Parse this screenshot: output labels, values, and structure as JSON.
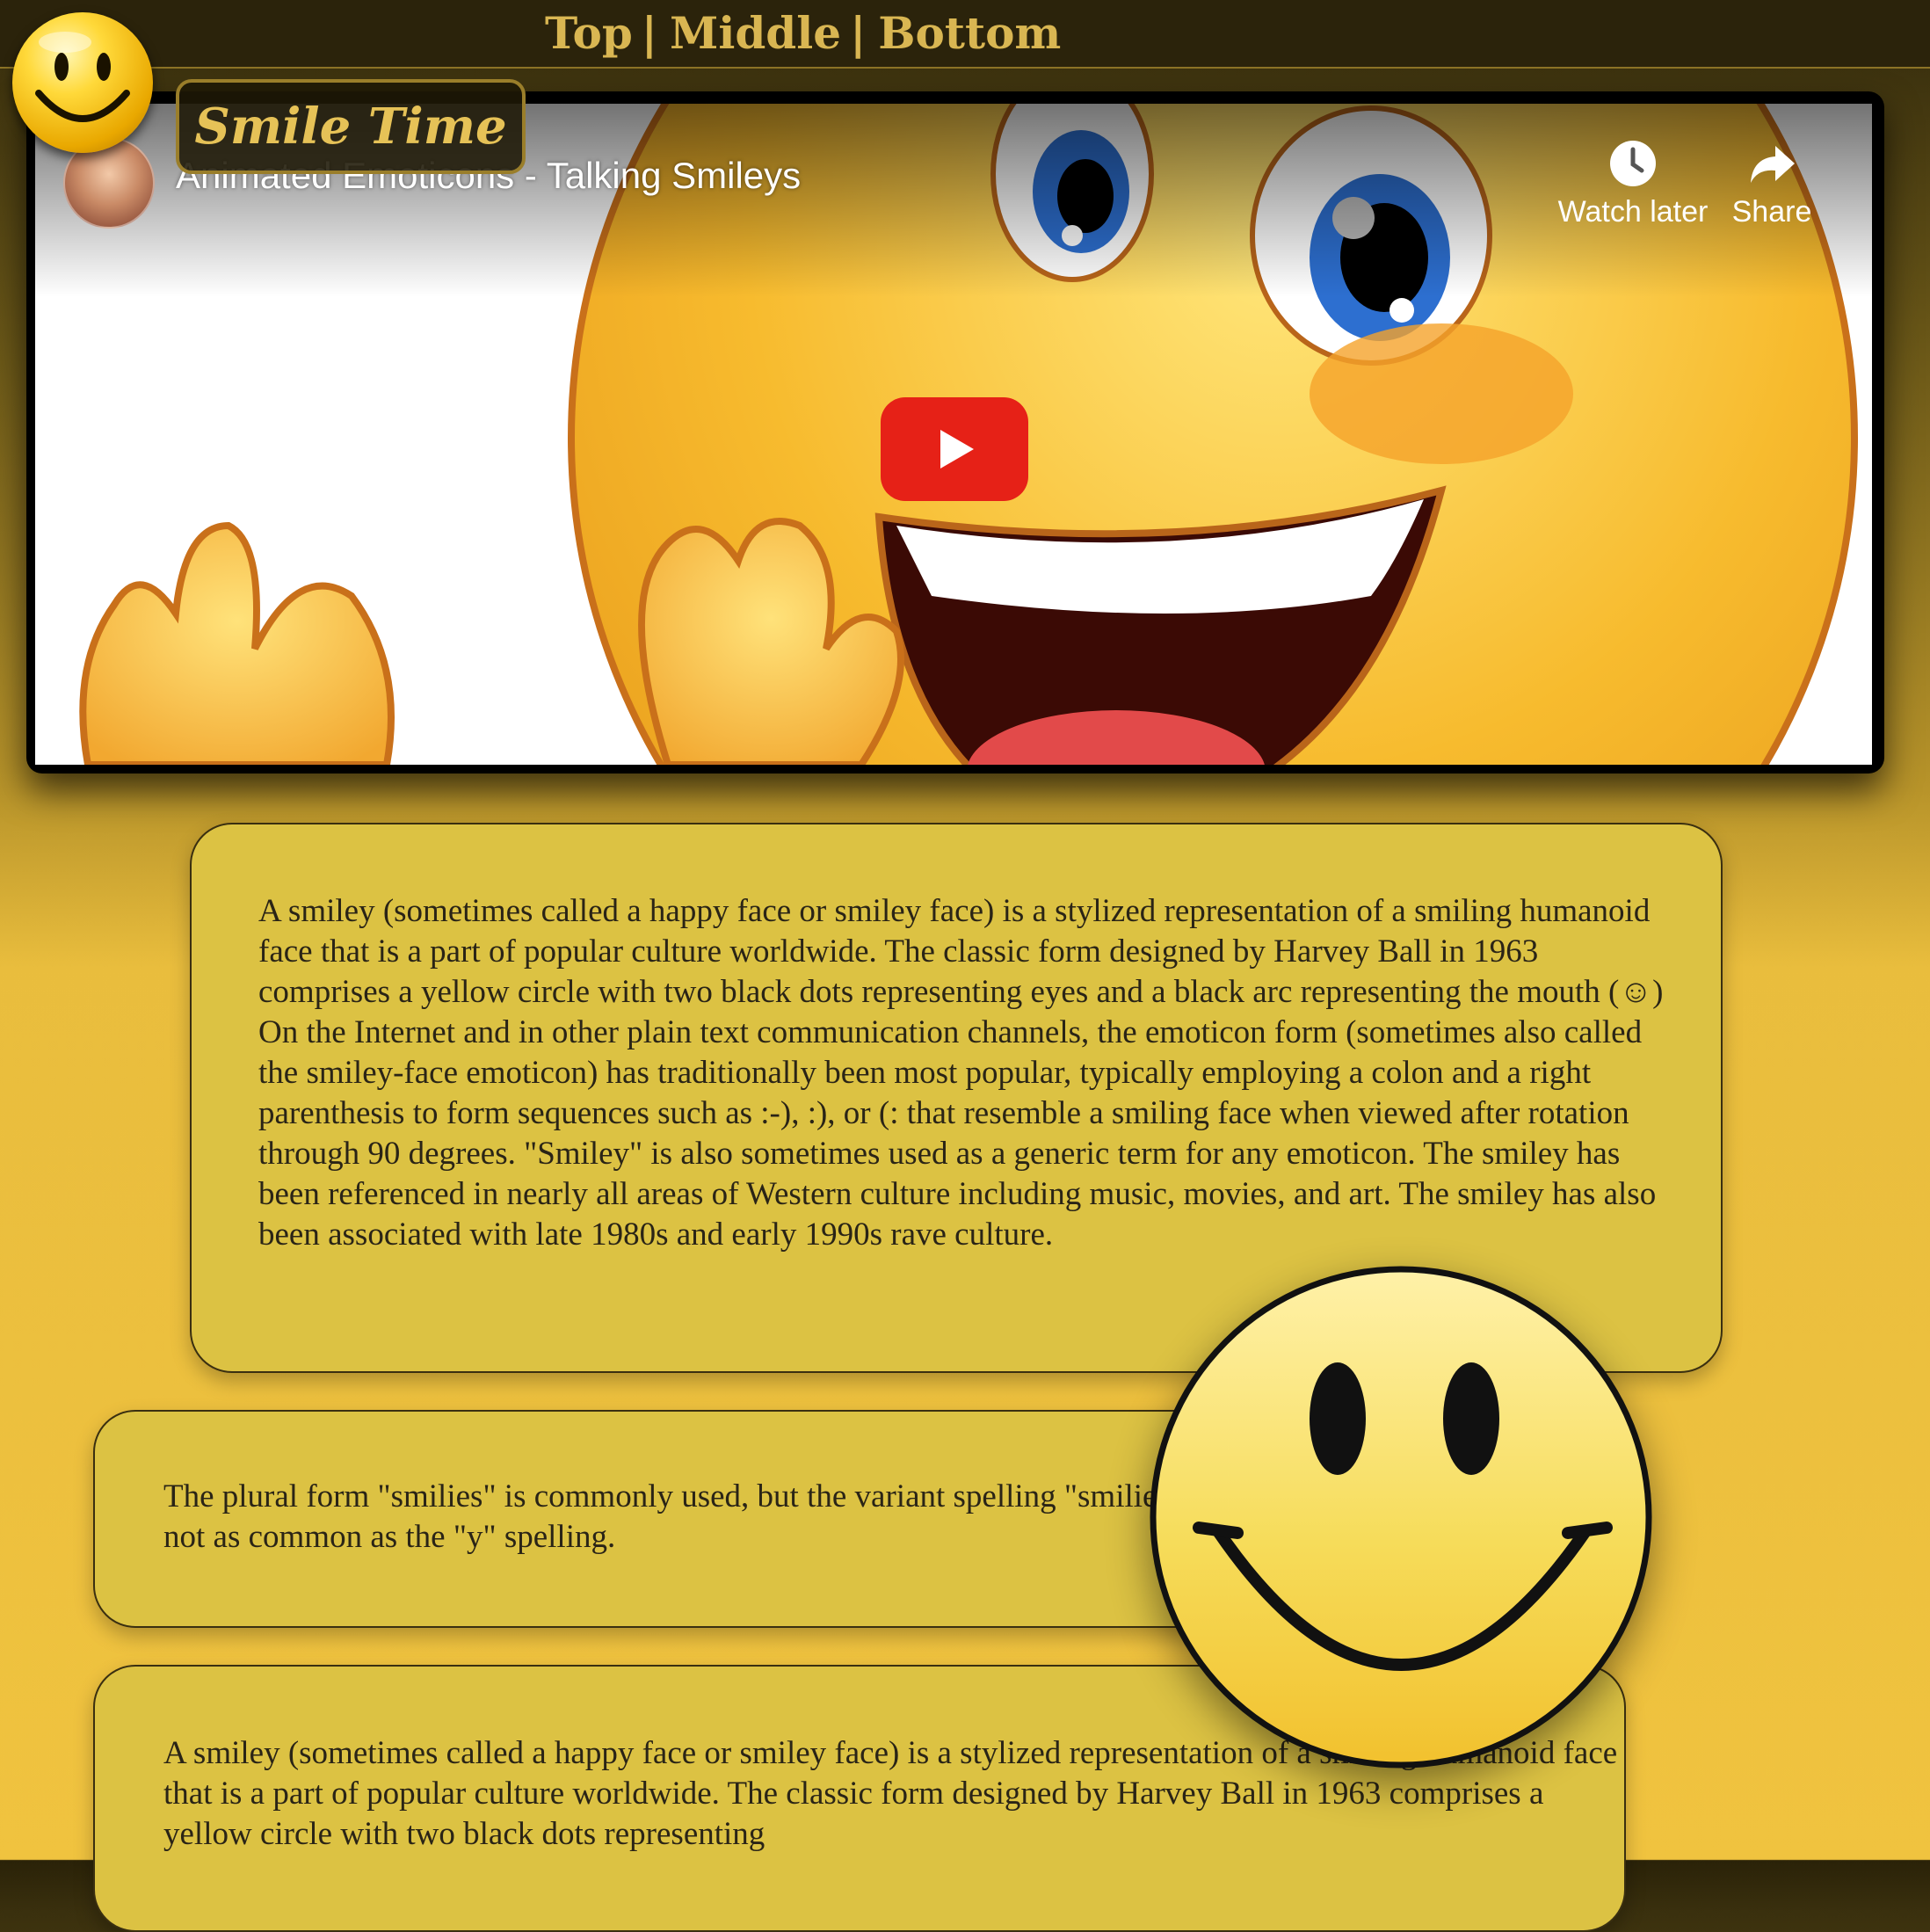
{
  "nav": {
    "links": [
      "Top",
      "Middle",
      "Bottom"
    ],
    "separator": "|"
  },
  "brand": {
    "title": "Smile Time"
  },
  "video": {
    "title": "Animated Emoticons - Talking Smileys",
    "watch_later_label": "Watch later",
    "share_label": "Share",
    "play_icon": "play-icon",
    "accent_color": "#e62117"
  },
  "content": {
    "paragraph1": "A smiley (sometimes called a happy face or smiley face) is a stylized representation of a smiling humanoid face that is a part of popular culture worldwide. The classic form designed by Harvey Ball in 1963 comprises a yellow circle with two black dots representing eyes and a black arc representing the mouth (☺) On the Internet and in other plain text communication channels, the emoticon form (sometimes also called the smiley-face emoticon) has traditionally been most popular, typically employing a colon and a right parenthesis to form sequences such as :-), :), or (: that resemble a smiling face when viewed after rotation through 90 degrees. \"Smiley\" is also sometimes used as a generic term for any emoticon. The smiley has been referenced in nearly all areas of Western culture including music, movies, and art. The smiley has also been associated with late 1980s and early 1990s rave culture.",
    "paragraph2": "The plural form \"smilies\" is commonly used, but the variant spelling \"smilie\" is not as common as the \"y\" spelling.",
    "paragraph3": "A smiley (sometimes called a happy face or smiley face) is a stylized representation of a smiling humanoid face that is a part of popular culture worldwide. The classic form designed by Harvey Ball in 1963 comprises a yellow circle with two black dots representing"
  },
  "colors": {
    "nav_bg": "#2b230b",
    "nav_text": "#d9b652",
    "card_bg": "#dcc243",
    "page_bg": "#f0c33f"
  }
}
